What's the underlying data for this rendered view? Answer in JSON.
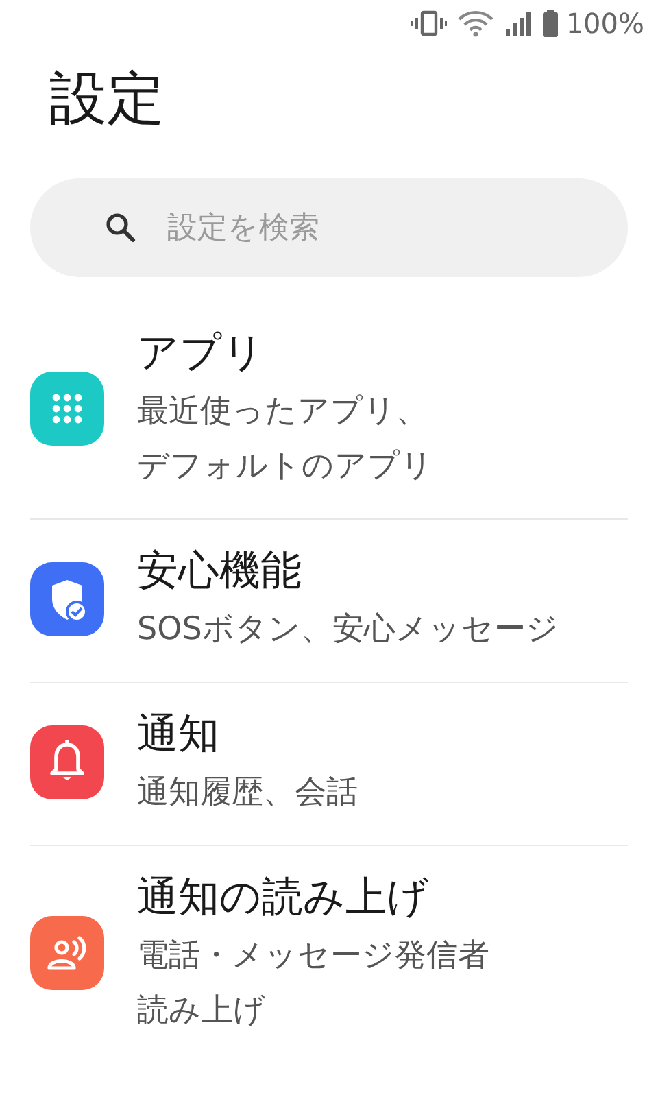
{
  "status_bar": {
    "battery_text": "100%"
  },
  "title": "設定",
  "search": {
    "placeholder": "設定を検索"
  },
  "items": [
    {
      "title": "アプリ",
      "subtitle_lines": [
        "最近使ったアプリ、",
        "デフォルトのアプリ"
      ],
      "kind": "grid",
      "color": "#1cc9c5"
    },
    {
      "title": "安心機能",
      "subtitle_lines": [
        "SOSボタン、安心メッセージ"
      ],
      "kind": "shield",
      "color": "#3f6ff4"
    },
    {
      "title": "通知",
      "subtitle_lines": [
        "通知履歴、会話"
      ],
      "kind": "bell",
      "color": "#f2474f"
    },
    {
      "title": "通知の読み上げ",
      "subtitle_lines": [
        "電話・メッセージ発信者",
        "読み上げ"
      ],
      "kind": "speaker",
      "color": "#f76a4b"
    }
  ]
}
